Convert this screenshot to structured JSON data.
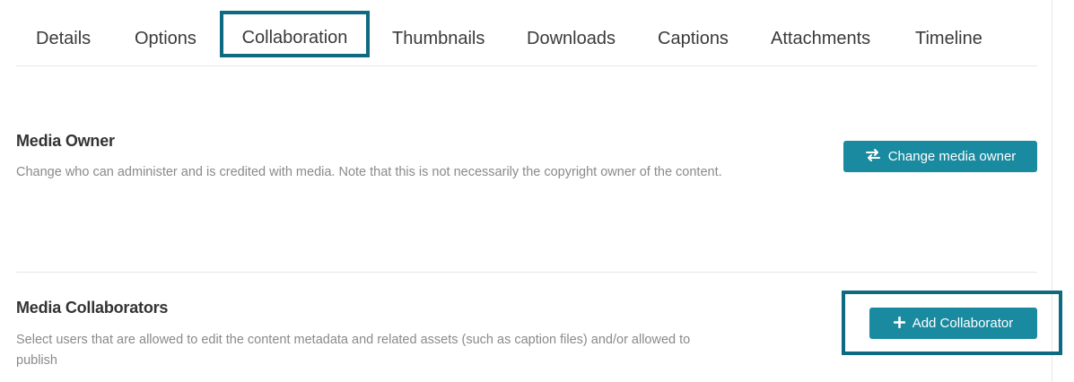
{
  "tabs": [
    {
      "label": "Details"
    },
    {
      "label": "Options"
    },
    {
      "label": "Collaboration",
      "active": true
    },
    {
      "label": "Thumbnails"
    },
    {
      "label": "Downloads"
    },
    {
      "label": "Captions"
    },
    {
      "label": "Attachments"
    },
    {
      "label": "Timeline"
    }
  ],
  "owner": {
    "title": "Media Owner",
    "description": "Change who can administer and is credited with media. Note that this is not necessarily the copyright owner of the content.",
    "button_label": "Change media owner",
    "button_icon": "swap-arrows-icon"
  },
  "collaborators": {
    "title": "Media Collaborators",
    "description": "Select users that are allowed to edit the content metadata and related assets (such as caption files) and/or allowed to publish",
    "button_label": "Add Collaborator",
    "button_icon": "plus-icon"
  },
  "colors": {
    "accent": "#1a8aa0",
    "highlight": "#0e6a80"
  }
}
